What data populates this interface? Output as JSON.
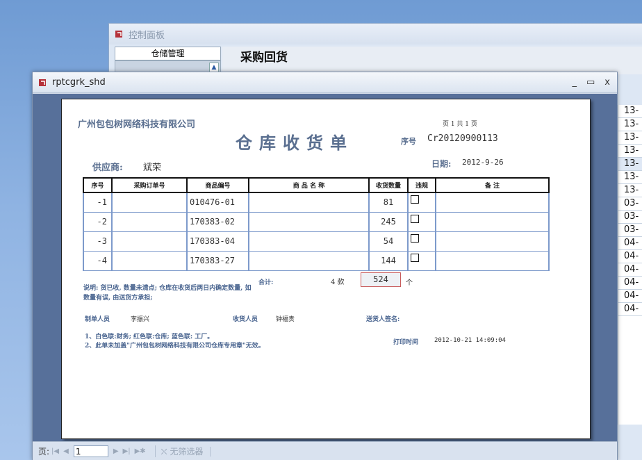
{
  "control_panel": {
    "title": "控制面板",
    "nav_group": "仓储管理",
    "heading": "采购回货",
    "grid_values": [
      "13-",
      "13-",
      "13-",
      "13-",
      "13-",
      "13-",
      "13-",
      "03-",
      "03-",
      "03-",
      "04-",
      "04-",
      "04-",
      "04-",
      "04-",
      "04-"
    ]
  },
  "report_window": {
    "title": "rptcgrk_shd",
    "controls": {
      "minimize": "_",
      "maximize": "▭",
      "close": "x"
    }
  },
  "report": {
    "company": "广州包包树网络科技有限公司",
    "page_info": "页 1 共 1 页",
    "doc_title": "仓库收货单",
    "no_label": "序号",
    "no_value": "Cr20120900113",
    "supplier_label": "供应商:",
    "supplier_value": "斌荣",
    "date_label": "日期:",
    "date_value": "2012-9-26",
    "columns": [
      "序号",
      "采购订单号",
      "商品编号",
      "商 品 名 称",
      "收货数量",
      "违规",
      "备    注"
    ],
    "rows": [
      {
        "seq": "-1",
        "po": "",
        "code": "010476-01",
        "name": "",
        "qty": "81",
        "remark": ""
      },
      {
        "seq": "-2",
        "po": "",
        "code": "170383-02",
        "name": "",
        "qty": "245",
        "remark": ""
      },
      {
        "seq": "-3",
        "po": "",
        "code": "170383-04",
        "name": "",
        "qty": "54",
        "remark": ""
      },
      {
        "seq": "-4",
        "po": "",
        "code": "170383-27",
        "name": "",
        "qty": "144",
        "remark": ""
      }
    ],
    "note": "说明: 货已收, 数量未清点; 仓库在收货后两日内确定数量, 如数量有误, 由送货方承担;",
    "total_label": "合计:",
    "total_items": "4 款",
    "total_qty": "524",
    "total_unit": "个",
    "maker_label": "制单人员",
    "maker_value": "李振兴",
    "receiver_label": "收货人员",
    "receiver_value": "钟福贵",
    "deliverer_label": "送货人签名:",
    "remark_1": "1、白色联:财务; 红色联:仓库; 蓝色联: 工厂。",
    "remark_2": "2、此单未加盖\"广州包包树网络科技有限公司仓库专用章\"无效。",
    "print_label": "打印时间",
    "print_value": "2012-10-21   14:09:04"
  },
  "navbar": {
    "page_label": "页:",
    "page_value": "1",
    "filter_label": "无筛选器"
  }
}
